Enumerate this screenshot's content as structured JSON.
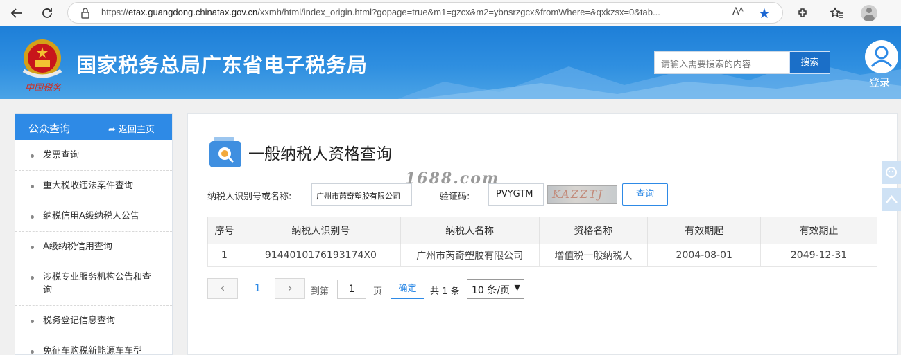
{
  "browser": {
    "url_prefix": "https://",
    "url_domain": "etax.guangdong.chinatax.gov.cn",
    "url_path": "/xxmh/html/index_origin.html?gopage=true&m1=gzcx&m2=ybnsrzgcx&fromWhere=&qxkzsx=0&tab...",
    "read_aloud": "Aᴬ"
  },
  "header": {
    "title": "国家税务总局广东省电子税务局",
    "emblem_text": "中国税务",
    "search_placeholder": "请输入需要搜索的内容",
    "search_button": "搜索",
    "login_label": "登录"
  },
  "sidebar": {
    "title": "公众查询",
    "home_link": "返回主页",
    "items": [
      {
        "label": "发票查询"
      },
      {
        "label": "重大税收违法案件查询"
      },
      {
        "label": "纳税信用A级纳税人公告"
      },
      {
        "label": "A级纳税信用查询"
      },
      {
        "label": "涉税专业服务机构公告和查询"
      },
      {
        "label": "税务登记信息查询"
      },
      {
        "label": "免征车购税新能源车车型"
      }
    ]
  },
  "main": {
    "page_title": "一般纳税人资格查询",
    "watermark": "1688.com",
    "form": {
      "taxpayer_label": "纳税人识别号或名称:",
      "taxpayer_value": "广州市芮奇塑胶有限公司",
      "captcha_label": "验证码:",
      "captcha_value": "PVYGTM",
      "captcha_image_text": "KAZZTJ",
      "query_button": "查询"
    },
    "table": {
      "headers": [
        "序号",
        "纳税人识别号",
        "纳税人名称",
        "资格名称",
        "有效期起",
        "有效期止"
      ],
      "rows": [
        [
          "1",
          "9144010176193174X0",
          "广州市芮奇塑胶有限公司",
          "增值税一般纳税人",
          "2004-08-01",
          "2049-12-31"
        ]
      ]
    },
    "pager": {
      "prev": "‹",
      "next": "›",
      "current_page": "1",
      "goto_label": "到第",
      "page_input": "1",
      "page_unit": "页",
      "confirm": "确定",
      "total": "共 1 条",
      "page_size": "10 条/页"
    }
  },
  "colors": {
    "header_blue": "#1e7fd8",
    "accent": "#2e8ae6"
  }
}
